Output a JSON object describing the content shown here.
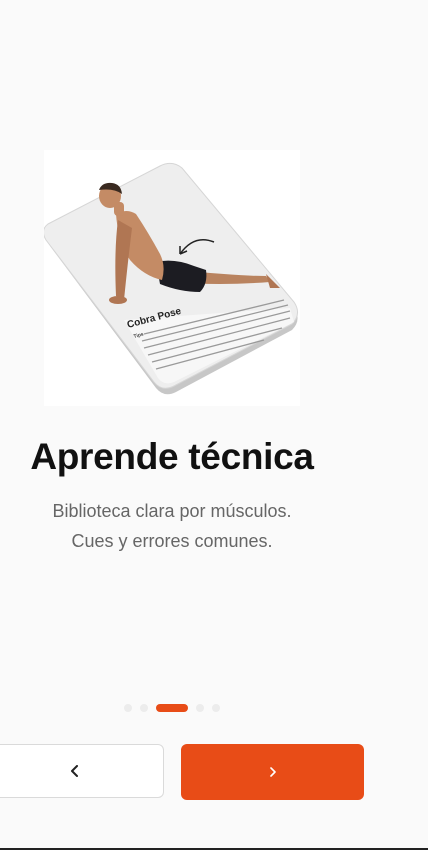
{
  "illustration": {
    "card_title": "Cobra Pose",
    "card_label": "Tips",
    "icon": "cobra-pose-illustration"
  },
  "onboarding": {
    "title": "Aprende técnica",
    "subtitle_lines": [
      "Biblioteca clara por músculos.",
      "Cues y errores comunes."
    ]
  },
  "pagination": {
    "total": 5,
    "current": 3
  },
  "navigation": {
    "back_icon": "chevron-left-icon",
    "next_icon": "chevron-right-icon"
  },
  "colors": {
    "accent": "#e84c17",
    "title": "#111111",
    "subtitle": "#666666",
    "background": "#fafafa"
  }
}
